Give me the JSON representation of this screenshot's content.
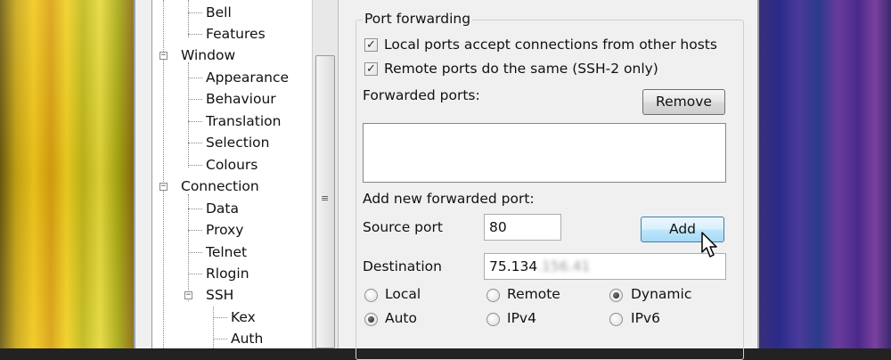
{
  "tree": {
    "items": [
      {
        "label": "Bell",
        "level": 2
      },
      {
        "label": "Features",
        "level": 2
      },
      {
        "label": "Window",
        "level": 1,
        "expanded": true
      },
      {
        "label": "Appearance",
        "level": 2
      },
      {
        "label": "Behaviour",
        "level": 2
      },
      {
        "label": "Translation",
        "level": 2
      },
      {
        "label": "Selection",
        "level": 2
      },
      {
        "label": "Colours",
        "level": 2
      },
      {
        "label": "Connection",
        "level": 1,
        "expanded": true
      },
      {
        "label": "Data",
        "level": 2
      },
      {
        "label": "Proxy",
        "level": 2
      },
      {
        "label": "Telnet",
        "level": 2
      },
      {
        "label": "Rlogin",
        "level": 2
      },
      {
        "label": "SSH",
        "level": 2,
        "expanded": true
      },
      {
        "label": "Kex",
        "level": 3
      },
      {
        "label": "Auth",
        "level": 3
      }
    ],
    "expander_symbol": "−"
  },
  "scrollbar": {
    "grip": "≡"
  },
  "port_forwarding": {
    "title": "Port forwarding",
    "local_accept": {
      "label": "Local ports accept connections from other hosts",
      "checked": true,
      "mark": "✓"
    },
    "remote_same": {
      "label": "Remote ports do the same (SSH-2 only)",
      "checked": true,
      "mark": "✓"
    },
    "forwarded_ports_label": "Forwarded ports:",
    "remove_label": "Remove",
    "add_new_label": "Add new forwarded port:",
    "source_port_label": "Source port",
    "source_port_value": "80",
    "add_label": "Add",
    "destination_label": "Destination",
    "destination_visible": "75.134",
    "destination_obscured": ".156.41",
    "direction_options": [
      {
        "label": "Local",
        "selected": false
      },
      {
        "label": "Remote",
        "selected": false
      },
      {
        "label": "Dynamic",
        "selected": true
      }
    ],
    "protocol_options": [
      {
        "label": "Auto",
        "selected": true
      },
      {
        "label": "IPv4",
        "selected": false
      },
      {
        "label": "IPv6",
        "selected": false
      }
    ]
  }
}
